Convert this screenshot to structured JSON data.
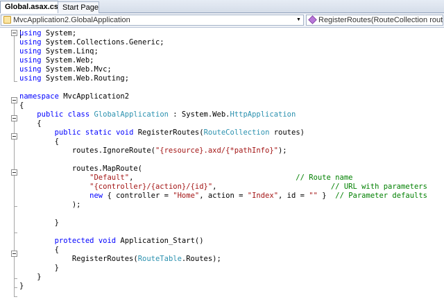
{
  "tabs": [
    {
      "label": "Global.asax.cs",
      "active": true
    },
    {
      "label": "Start Page",
      "active": false
    }
  ],
  "nav": {
    "type_combo": "MvcApplication2.GlobalApplication",
    "member_combo": "RegisterRoutes(RouteCollection routes)"
  },
  "colors": {
    "keyword": "#0000ff",
    "type": "#2b91af",
    "string": "#a31515",
    "comment": "#008000"
  },
  "code_lines": [
    [
      {
        "t": "using",
        "c": "kw"
      },
      {
        "t": " System;"
      }
    ],
    [
      {
        "t": "using",
        "c": "kw"
      },
      {
        "t": " System.Collections.Generic;"
      }
    ],
    [
      {
        "t": "using",
        "c": "kw"
      },
      {
        "t": " System.Linq;"
      }
    ],
    [
      {
        "t": "using",
        "c": "kw"
      },
      {
        "t": " System.Web;"
      }
    ],
    [
      {
        "t": "using",
        "c": "kw"
      },
      {
        "t": " System.Web.Mvc;"
      }
    ],
    [
      {
        "t": "using",
        "c": "kw"
      },
      {
        "t": " System.Web.Routing;"
      }
    ],
    [],
    [
      {
        "t": "namespace",
        "c": "kw"
      },
      {
        "t": " MvcApplication2"
      }
    ],
    [
      {
        "t": "{"
      }
    ],
    [
      {
        "t": "    "
      },
      {
        "t": "public",
        "c": "kw"
      },
      {
        "t": " "
      },
      {
        "t": "class",
        "c": "kw"
      },
      {
        "t": " "
      },
      {
        "t": "GlobalApplication",
        "c": "ty"
      },
      {
        "t": " : System.Web."
      },
      {
        "t": "HttpApplication",
        "c": "ty"
      }
    ],
    [
      {
        "t": "    {"
      }
    ],
    [
      {
        "t": "        "
      },
      {
        "t": "public",
        "c": "kw"
      },
      {
        "t": " "
      },
      {
        "t": "static",
        "c": "kw"
      },
      {
        "t": " "
      },
      {
        "t": "void",
        "c": "kw"
      },
      {
        "t": " RegisterRoutes("
      },
      {
        "t": "RouteCollection",
        "c": "ty"
      },
      {
        "t": " routes)"
      }
    ],
    [
      {
        "t": "        {"
      }
    ],
    [
      {
        "t": "            routes.IgnoreRoute("
      },
      {
        "t": "\"{resource}.axd/{*pathInfo}\"",
        "c": "st"
      },
      {
        "t": ");"
      }
    ],
    [],
    [
      {
        "t": "            routes.MapRoute("
      }
    ],
    [
      {
        "t": "                "
      },
      {
        "t": "\"Default\"",
        "c": "st"
      },
      {
        "t": ",                                     "
      },
      {
        "t": "// Route name",
        "c": "cm"
      }
    ],
    [
      {
        "t": "                "
      },
      {
        "t": "\"{controller}/{action}/{id}\"",
        "c": "st"
      },
      {
        "t": ",                          "
      },
      {
        "t": "// URL with parameters",
        "c": "cm"
      }
    ],
    [
      {
        "t": "                "
      },
      {
        "t": "new",
        "c": "kw"
      },
      {
        "t": " { controller = "
      },
      {
        "t": "\"Home\"",
        "c": "st"
      },
      {
        "t": ", action = "
      },
      {
        "t": "\"Index\"",
        "c": "st"
      },
      {
        "t": ", id = "
      },
      {
        "t": "\"\"",
        "c": "st"
      },
      {
        "t": " }  "
      },
      {
        "t": "// Parameter defaults",
        "c": "cm"
      }
    ],
    [
      {
        "t": "            );"
      }
    ],
    [],
    [
      {
        "t": "        }"
      }
    ],
    [],
    [
      {
        "t": "        "
      },
      {
        "t": "protected",
        "c": "kw"
      },
      {
        "t": " "
      },
      {
        "t": "void",
        "c": "kw"
      },
      {
        "t": " Application_Start()"
      }
    ],
    [
      {
        "t": "        {"
      }
    ],
    [
      {
        "t": "            RegisterRoutes("
      },
      {
        "t": "RouteTable",
        "c": "ty"
      },
      {
        "t": ".Routes);"
      }
    ],
    [
      {
        "t": "        }"
      }
    ],
    [
      {
        "t": "    }"
      }
    ],
    [
      {
        "t": "}"
      }
    ]
  ]
}
